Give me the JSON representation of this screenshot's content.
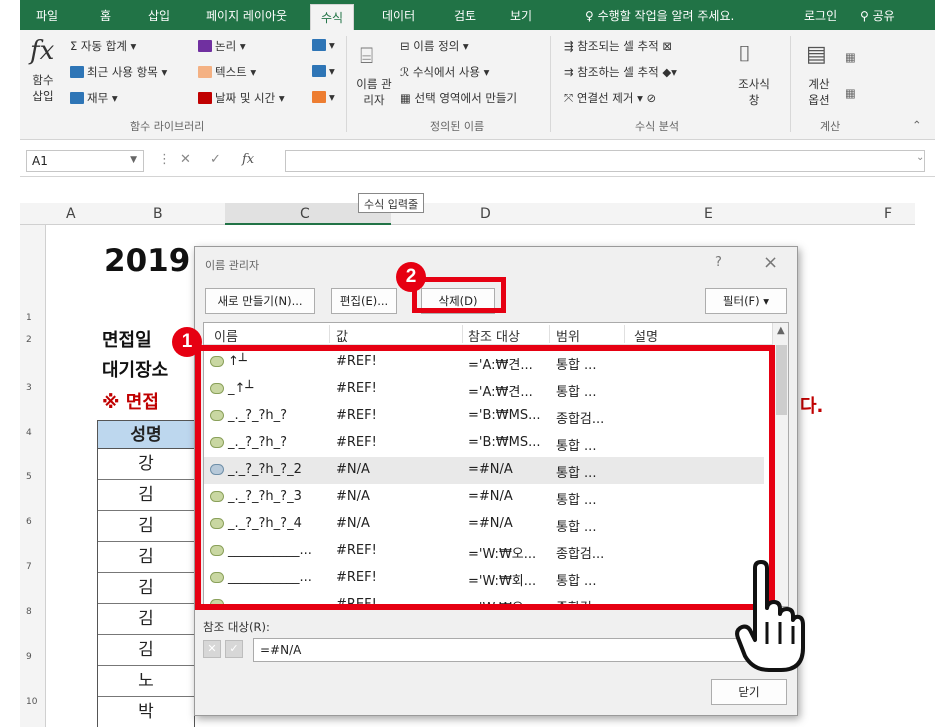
{
  "tabs": [
    {
      "label": "파일",
      "active": false
    },
    {
      "label": "홈",
      "active": false
    },
    {
      "label": "삽입",
      "active": false
    },
    {
      "label": "페이지 레이아웃",
      "active": false
    },
    {
      "label": "수식",
      "active": true
    },
    {
      "label": "데이터",
      "active": false
    },
    {
      "label": "검토",
      "active": false
    },
    {
      "label": "보기",
      "active": false
    }
  ],
  "tellme": "수행할 작업을 알려 주세요.",
  "login": "로그인",
  "share": "공유",
  "ribbon": {
    "insert_function": "함수 삽입",
    "autosum": "자동 합계",
    "recent": "최근 사용 항목",
    "finance": "재무",
    "logical": "논리",
    "text": "텍스트",
    "datetime": "날짜 및 시간",
    "library_label": "함수 라이브러리",
    "name_manager": "이름 관리자",
    "define_name": "이름 정의",
    "use_in_formula": "수식에서 사용",
    "create_from_selection": "선택 영역에서 만들기",
    "defined_names_label": "정의된 이름",
    "trace_precedents": "참조되는 셀 추적",
    "trace_dependents": "참조하는 셀 추적",
    "remove_arrows": "연결선 제거",
    "watch_window": "조사식 창",
    "auditing_label": "수식 분석",
    "calc_options": "계산 옵션",
    "calc_label": "계산"
  },
  "formula_bar": {
    "cell_ref": "A1",
    "fx": "fx",
    "value": ""
  },
  "tooltip": "수식 입력줄",
  "columns": [
    "A",
    "B",
    "C",
    "D",
    "E",
    "F"
  ],
  "rows": [
    "1",
    "2",
    "3",
    "4",
    "5",
    "6",
    "7",
    "8",
    "9",
    "10"
  ],
  "sheet": {
    "title": "2019",
    "line1": "면접일",
    "line2": "대기장소",
    "line3": "※ 면접",
    "tail": "다.",
    "table_header": "성명",
    "names": [
      "강",
      "김",
      "김",
      "김",
      "김",
      "김",
      "김",
      "노",
      "박"
    ]
  },
  "dialog": {
    "title": "이름 관리자",
    "help": "?",
    "close": "×",
    "new_btn": "새로 만들기(N)...",
    "edit_btn": "편집(E)...",
    "delete_btn": "삭제(D)",
    "filter_btn": "필터(F) ▾",
    "headers": {
      "name": "이름",
      "value": "값",
      "refers": "참조 대상",
      "scope": "범위",
      "comment": "설명"
    },
    "rows": [
      {
        "name": "↑┴",
        "value": "#REF!",
        "refers": "='A:₩견...",
        "scope": "통합 ...",
        "selected": false
      },
      {
        "name": "_↑┴",
        "value": "#REF!",
        "refers": "='A:₩견...",
        "scope": "통합 ...",
        "selected": false
      },
      {
        "name": "_._?_?h_?",
        "value": "#REF!",
        "refers": "='B:₩MS...",
        "scope": "종합검...",
        "selected": false
      },
      {
        "name": "_._?_?h_?",
        "value": "#REF!",
        "refers": "='B:₩MS...",
        "scope": "통합 ...",
        "selected": false
      },
      {
        "name": "_._?_?h_?_2",
        "value": "#N/A",
        "refers": "=#N/A",
        "scope": "통합 ...",
        "selected": true
      },
      {
        "name": "_._?_?h_?_3",
        "value": "#N/A",
        "refers": "=#N/A",
        "scope": "통합 ...",
        "selected": false
      },
      {
        "name": "_._?_?h_?_4",
        "value": "#N/A",
        "refers": "=#N/A",
        "scope": "통합 ...",
        "selected": false
      },
      {
        "name": "___________...",
        "value": "#REF!",
        "refers": "='W:₩오...",
        "scope": "종합검...",
        "selected": false
      },
      {
        "name": "___________...",
        "value": "#REF!",
        "refers": "='W:₩회...",
        "scope": "통합 ...",
        "selected": false
      },
      {
        "name": "___________...",
        "value": "#REF!",
        "refers": "='W:₩오...",
        "scope": "종합검...",
        "selected": false
      }
    ],
    "refers_label": "참조 대상(R):",
    "refers_value": "=#N/A",
    "close_btn": "닫기"
  },
  "annotations": {
    "badge1": "1",
    "badge2": "2",
    "accent": "#e60012"
  }
}
